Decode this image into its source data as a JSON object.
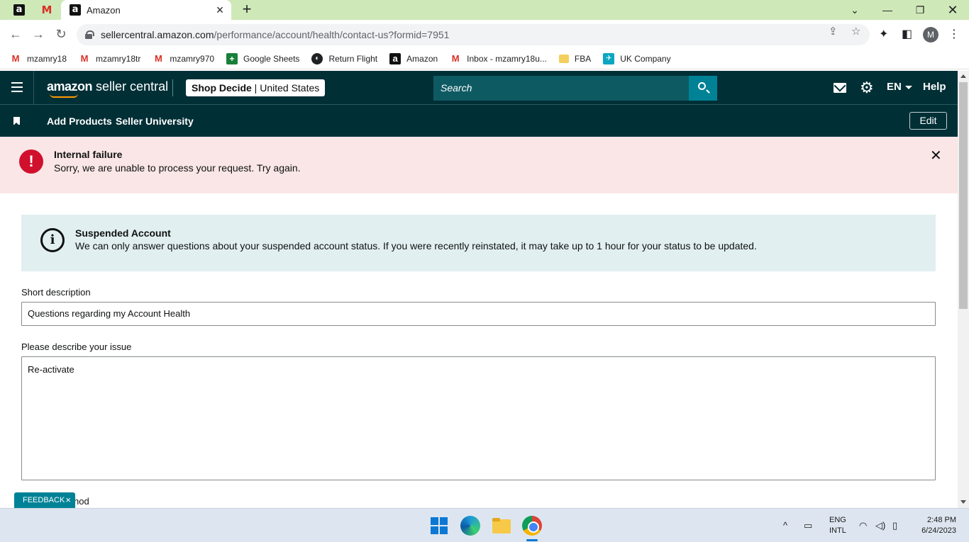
{
  "browser": {
    "active_tab_title": "Amazon",
    "url_host": "sellercentral.amazon.com",
    "url_path": "/performance/account/health/contact-us?formid=7951",
    "profile_initial": "M",
    "bookmarks": [
      {
        "label": "mzamry18",
        "icon": "gmail-icon"
      },
      {
        "label": "mzamry18tr",
        "icon": "gmail-icon"
      },
      {
        "label": "mzamry970",
        "icon": "gmail-icon"
      },
      {
        "label": "Google Sheets",
        "icon": "sheets-icon"
      },
      {
        "label": "Return Flight",
        "icon": "globe-icon"
      },
      {
        "label": "Amazon",
        "icon": "amazon-icon"
      },
      {
        "label": "Inbox - mzamry18u...",
        "icon": "gmail-icon"
      },
      {
        "label": "FBA",
        "icon": "folder-icon"
      },
      {
        "label": "UK Company",
        "icon": "uk-company-icon"
      }
    ]
  },
  "header": {
    "logo_brand": "amazon",
    "logo_product": "seller central",
    "store_name": "Shop Decide",
    "store_region": "United States",
    "search_placeholder": "Search",
    "language": "EN",
    "help_label": "Help"
  },
  "subnav": {
    "links": [
      "Add Products",
      "Seller University"
    ],
    "edit_label": "Edit"
  },
  "error_alert": {
    "title": "Internal failure",
    "message": "Sorry, we are unable to process your request. Try again."
  },
  "info_alert": {
    "title": "Suspended Account",
    "message": "We can only answer questions about your suspended account status. If you were recently reinstated, it may take up to 1 hour for your status to be updated."
  },
  "form": {
    "short_description_label": "Short description",
    "short_description_value": "Questions regarding my Account Health",
    "issue_label": "Please describe your issue",
    "issue_value": "Re-activate",
    "partial_label": "hod"
  },
  "feedback": {
    "label": "FEEDBACK"
  },
  "taskbar": {
    "lang_line1": "ENG",
    "lang_line2": "INTL",
    "time": "2:48 PM",
    "date": "6/24/2023"
  },
  "colors": {
    "header_bg": "#002f36",
    "search_button": "#008296",
    "error_bg": "#fae6e6",
    "error_icon": "#d0102d",
    "info_bg": "#e2eff1",
    "tabstrip": "#cfe8b8"
  }
}
